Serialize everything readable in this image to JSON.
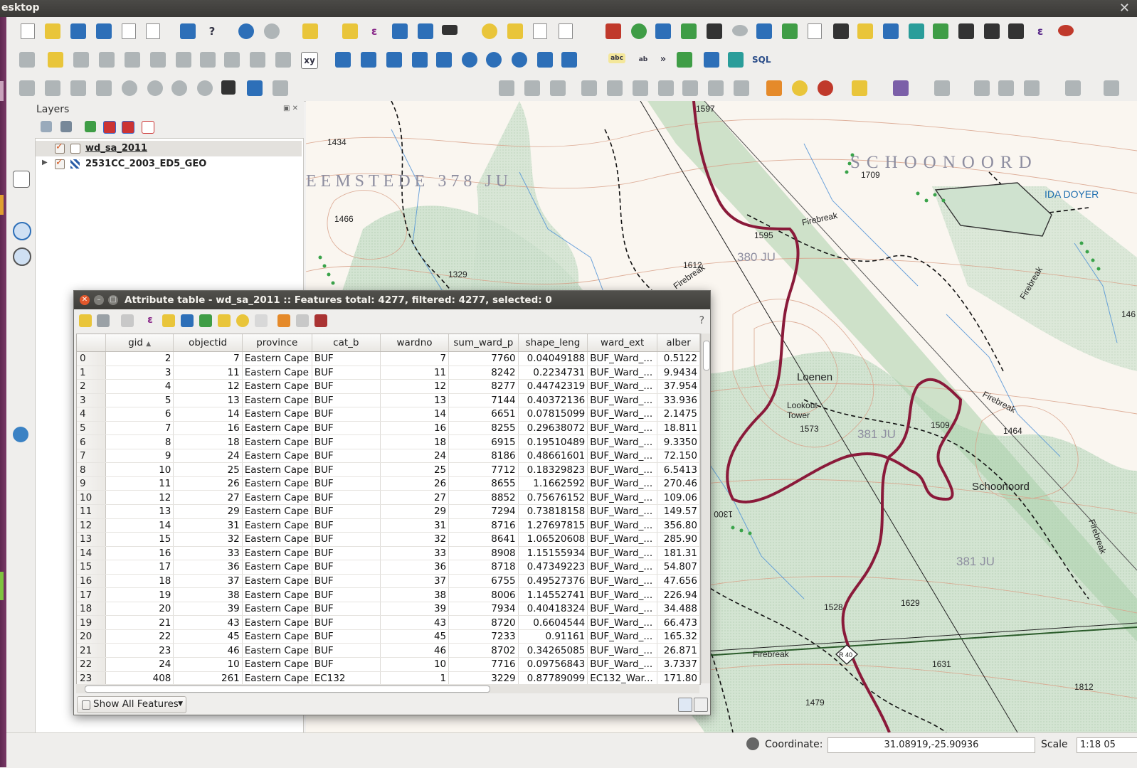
{
  "window": {
    "title": "esktop"
  },
  "layers_panel": {
    "title": "Layers",
    "items": [
      {
        "name": "wd_sa_2011",
        "checked": true
      },
      {
        "name": "2531CC_2003_ED5_GEO",
        "checked": true
      }
    ]
  },
  "map": {
    "labels": [
      "1434",
      "EEMSTEDE 378 JU",
      "1466",
      "1329",
      "1597",
      "SCHOONOORD",
      "1709",
      "IDA DOYER",
      "Firebreak",
      "1595",
      "380 JU",
      "1612",
      "Firebreak",
      "Loenen",
      "Lookout",
      "Tower",
      "1573",
      "381 JU",
      "1509",
      "1464",
      "Firebreak",
      "Schoonoord",
      "1300",
      "381 JU",
      "1528",
      "1629",
      "Firebreak",
      "1631",
      "1479",
      "1812",
      "146",
      "Firebreak",
      "R 40",
      "Firebreak"
    ]
  },
  "attribute_table": {
    "title": "Attribute table - wd_sa_2011 :: Features total: 4277, filtered: 4277, selected: 0",
    "help": "?",
    "columns": [
      "gid",
      "objectid",
      "province",
      "cat_b",
      "wardno",
      "sum_ward_p",
      "shape_leng",
      "ward_ext",
      "alber"
    ],
    "rows": [
      [
        "0",
        "2",
        "7",
        "Eastern Cape",
        "BUF",
        "7",
        "7760",
        "0.04049188",
        "BUF_Ward_...",
        "0.5122"
      ],
      [
        "1",
        "3",
        "11",
        "Eastern Cape",
        "BUF",
        "11",
        "8242",
        "0.2234731",
        "BUF_Ward_...",
        "9.9434"
      ],
      [
        "2",
        "4",
        "12",
        "Eastern Cape",
        "BUF",
        "12",
        "8277",
        "0.44742319",
        "BUF_Ward_...",
        "37.954"
      ],
      [
        "3",
        "5",
        "13",
        "Eastern Cape",
        "BUF",
        "13",
        "7144",
        "0.40372136",
        "BUF_Ward_...",
        "33.936"
      ],
      [
        "4",
        "6",
        "14",
        "Eastern Cape",
        "BUF",
        "14",
        "6651",
        "0.07815099",
        "BUF_Ward_...",
        "2.1475"
      ],
      [
        "5",
        "7",
        "16",
        "Eastern Cape",
        "BUF",
        "16",
        "8255",
        "0.29638072",
        "BUF_Ward_...",
        "18.811"
      ],
      [
        "6",
        "8",
        "18",
        "Eastern Cape",
        "BUF",
        "18",
        "6915",
        "0.19510489",
        "BUF_Ward_...",
        "9.3350"
      ],
      [
        "7",
        "9",
        "24",
        "Eastern Cape",
        "BUF",
        "24",
        "8186",
        "0.48661601",
        "BUF_Ward_...",
        "72.150"
      ],
      [
        "8",
        "10",
        "25",
        "Eastern Cape",
        "BUF",
        "25",
        "7712",
        "0.18329823",
        "BUF_Ward_...",
        "6.5413"
      ],
      [
        "9",
        "11",
        "26",
        "Eastern Cape",
        "BUF",
        "26",
        "8655",
        "1.1662592",
        "BUF_Ward_...",
        "270.46"
      ],
      [
        "10",
        "12",
        "27",
        "Eastern Cape",
        "BUF",
        "27",
        "8852",
        "0.75676152",
        "BUF_Ward_...",
        "109.06"
      ],
      [
        "11",
        "13",
        "29",
        "Eastern Cape",
        "BUF",
        "29",
        "7294",
        "0.73818158",
        "BUF_Ward_...",
        "149.57"
      ],
      [
        "12",
        "14",
        "31",
        "Eastern Cape",
        "BUF",
        "31",
        "8716",
        "1.27697815",
        "BUF_Ward_...",
        "356.80"
      ],
      [
        "13",
        "15",
        "32",
        "Eastern Cape",
        "BUF",
        "32",
        "8641",
        "1.06520608",
        "BUF_Ward_...",
        "285.90"
      ],
      [
        "14",
        "16",
        "33",
        "Eastern Cape",
        "BUF",
        "33",
        "8908",
        "1.15155934",
        "BUF_Ward_...",
        "181.31"
      ],
      [
        "15",
        "17",
        "36",
        "Eastern Cape",
        "BUF",
        "36",
        "8718",
        "0.47349223",
        "BUF_Ward_...",
        "54.807"
      ],
      [
        "16",
        "18",
        "37",
        "Eastern Cape",
        "BUF",
        "37",
        "6755",
        "0.49527376",
        "BUF_Ward_...",
        "47.656"
      ],
      [
        "17",
        "19",
        "38",
        "Eastern Cape",
        "BUF",
        "38",
        "8006",
        "1.14552741",
        "BUF_Ward_...",
        "226.94"
      ],
      [
        "18",
        "20",
        "39",
        "Eastern Cape",
        "BUF",
        "39",
        "7934",
        "0.40418324",
        "BUF_Ward_...",
        "34.488"
      ],
      [
        "19",
        "21",
        "43",
        "Eastern Cape",
        "BUF",
        "43",
        "8720",
        "0.6604544",
        "BUF_Ward_...",
        "66.473"
      ],
      [
        "20",
        "22",
        "45",
        "Eastern Cape",
        "BUF",
        "45",
        "7233",
        "0.91161",
        "BUF_Ward_...",
        "165.32"
      ],
      [
        "21",
        "23",
        "46",
        "Eastern Cape",
        "BUF",
        "46",
        "8702",
        "0.34265085",
        "BUF_Ward_...",
        "26.871"
      ],
      [
        "22",
        "24",
        "10",
        "Eastern Cape",
        "BUF",
        "10",
        "7716",
        "0.09756843",
        "BUF_Ward_...",
        "3.7337"
      ],
      [
        "23",
        "408",
        "261",
        "Eastern Cape",
        "EC132",
        "1",
        "3229",
        "0.87789099",
        "EC132_War...",
        "171.80"
      ]
    ],
    "show_features": "Show All Features"
  },
  "status": {
    "coordinate_label": "Coordinate:",
    "coordinate_value": "31.08919,-25.90936",
    "scale_label": "Scale",
    "scale_value": "1:18 05"
  },
  "toolbar": {
    "xy_label": "xy",
    "abc_label": "abc",
    "sql_label": "SQL",
    "more_label": "»"
  }
}
